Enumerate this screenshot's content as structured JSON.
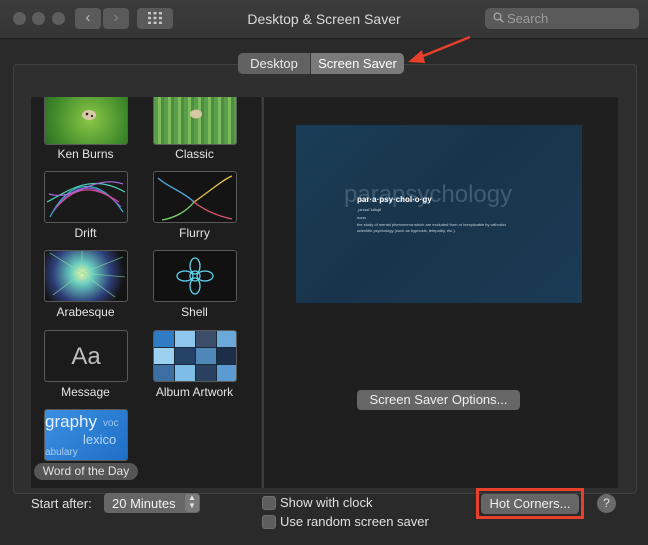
{
  "window": {
    "title": "Desktop & Screen Saver"
  },
  "toolbar": {
    "back_glyph": "‹",
    "forward_glyph": "›",
    "search_placeholder": "Search"
  },
  "tabs": [
    {
      "label": "Desktop",
      "selected": false
    },
    {
      "label": "Screen Saver",
      "selected": true
    }
  ],
  "savers": [
    {
      "label": "Ken Burns"
    },
    {
      "label": "Classic"
    },
    {
      "label": "Drift"
    },
    {
      "label": "Flurry"
    },
    {
      "label": "Arabesque"
    },
    {
      "label": "Shell"
    },
    {
      "label": "Message",
      "thumb_text": "Aa"
    },
    {
      "label": "Album Artwork"
    },
    {
      "label": "Word of the Day",
      "selected": true,
      "thumb_words": [
        "graphy",
        "lexico",
        "abulary",
        "voc"
      ]
    }
  ],
  "preview": {
    "word": "par·a·psy·chol·o·gy",
    "big_word": "parapsychology",
    "pronunciation": "ˌperəsīˈkäləjē",
    "part_of_speech": "noun",
    "definition": "the study of mental phenomena which are excluded from or inexplicable by orthodox scientific psychology (such as hypnosis, telepathy, etc.)."
  },
  "options_button": "Screen Saver Options...",
  "footer": {
    "start_after_label": "Start after:",
    "start_after_value": "20 Minutes",
    "show_clock_label": "Show with clock",
    "show_clock_checked": false,
    "random_label": "Use random screen saver",
    "random_checked": false,
    "hot_corners_label": "Hot Corners...",
    "help_glyph": "?"
  },
  "colors": {
    "annotation_red": "#e8402a",
    "window_bg": "#2a2a2a"
  }
}
